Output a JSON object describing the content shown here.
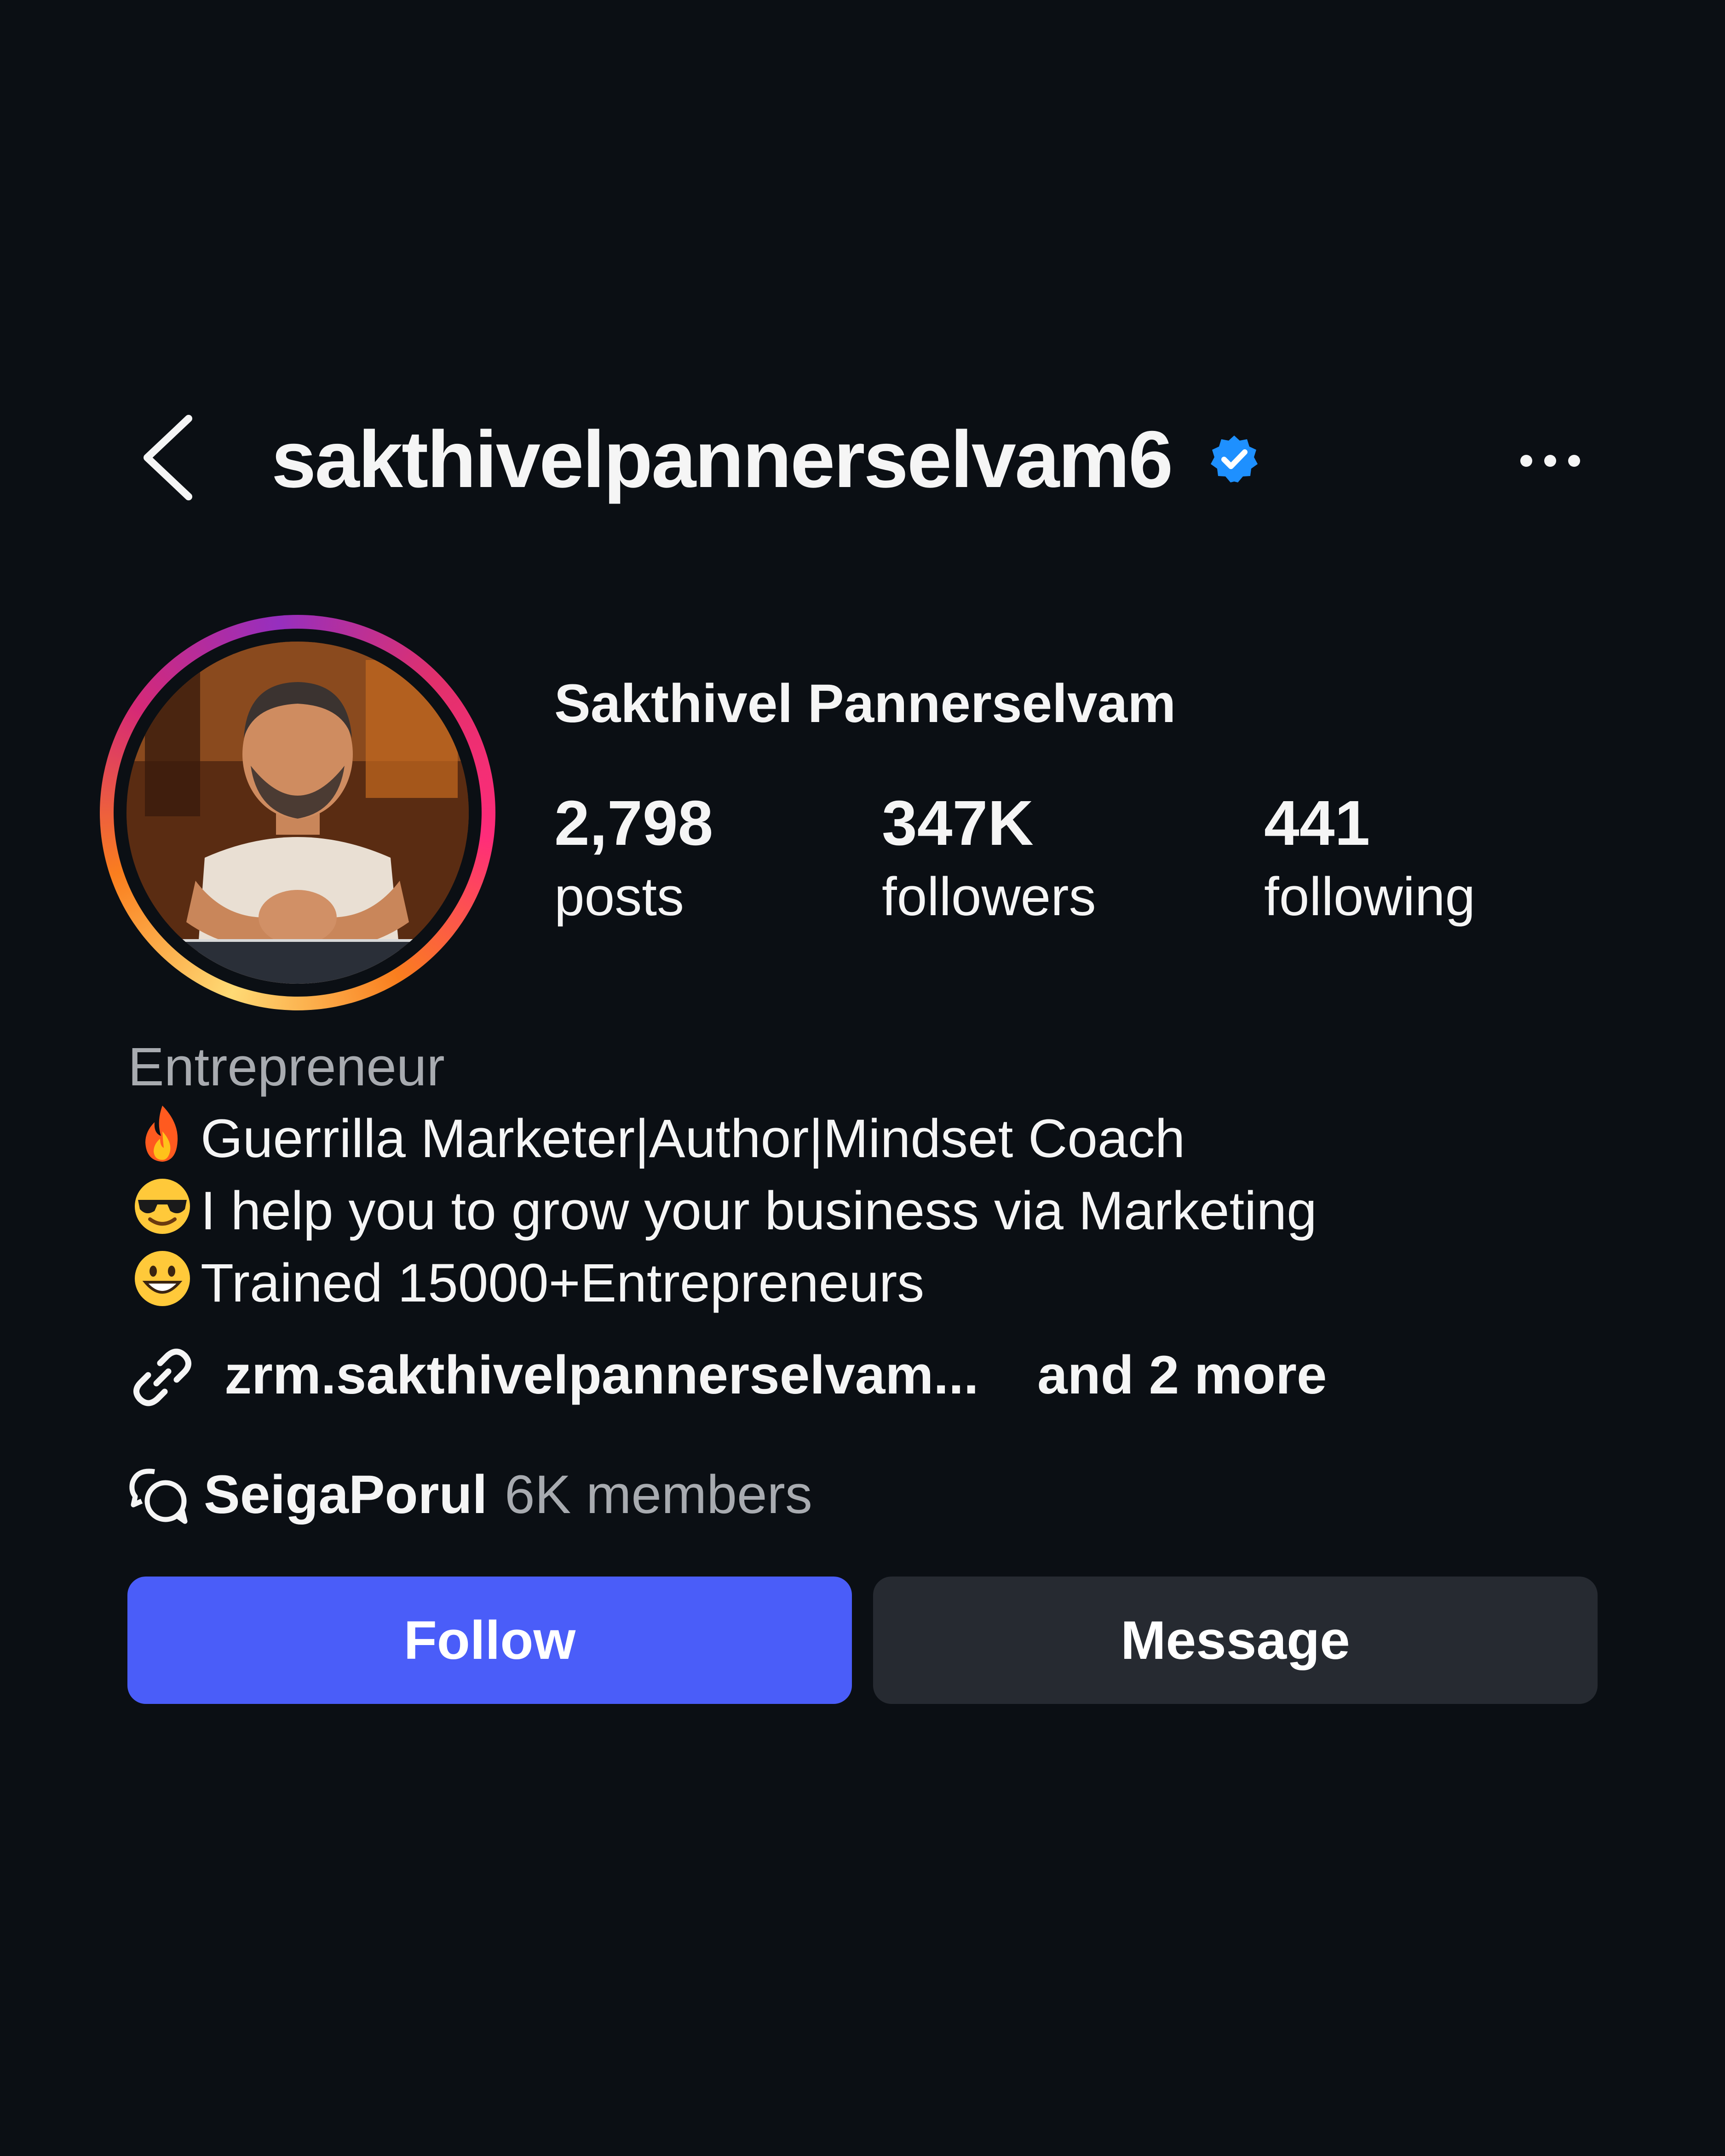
{
  "header": {
    "username": "sakthivelpannerselvam6",
    "icons": {
      "back": "back-chevron-icon",
      "verified": "verified-badge-icon",
      "more": "more-options-icon"
    },
    "verified_color": "#1e90ff"
  },
  "profile": {
    "display_name": "Sakthivel Pannerselvam",
    "avatar": "profile-photo",
    "stats": [
      {
        "value": "2,798",
        "label": "posts"
      },
      {
        "value": "347K",
        "label": "followers"
      },
      {
        "value": "441",
        "label": "following"
      }
    ]
  },
  "bio": {
    "category": "Entrepreneur",
    "lines": [
      {
        "emoji": "fire-icon",
        "text": "Guerrilla Marketer|Author|Mindset Coach"
      },
      {
        "emoji": "sunglasses-face-icon",
        "text": "I help you to grow your business via Marketing"
      },
      {
        "emoji": "grinning-face-icon",
        "text": "Trained 15000+Entrepreneurs"
      }
    ]
  },
  "link": {
    "icon": "link-icon",
    "text": "zrm.sakthivelpannerselvam...",
    "more": "and 2 more"
  },
  "community": {
    "icon": "chat-bubbles-icon",
    "name": "SeigaPorul",
    "members": "6K members"
  },
  "actions": {
    "follow_label": "Follow",
    "message_label": "Message",
    "follow_color": "#4a5df9",
    "message_color": "#262a31"
  },
  "colors": {
    "background": "#0b0f14",
    "secondary_text": "#a8abb0"
  }
}
